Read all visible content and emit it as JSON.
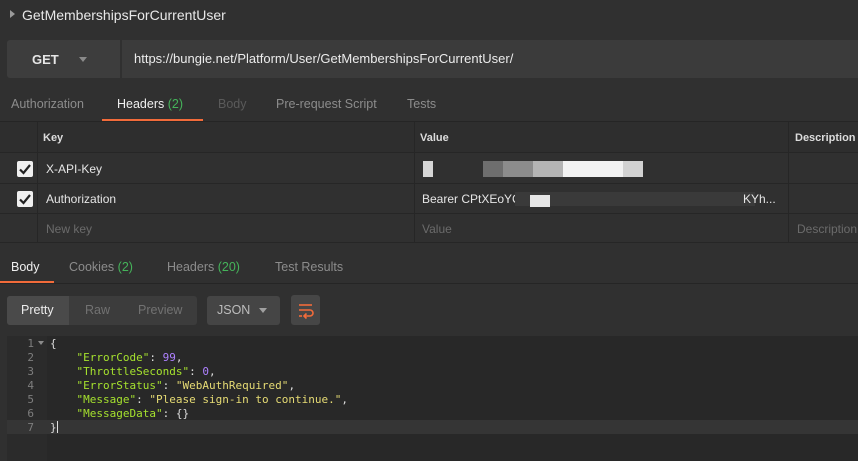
{
  "request": {
    "title": "GetMembershipsForCurrentUser",
    "method": "GET",
    "url": "https://bungie.net/Platform/User/GetMembershipsForCurrentUser/"
  },
  "request_tabs": {
    "authorization": "Authorization",
    "headers": "Headers",
    "headers_count": "(2)",
    "body": "Body",
    "pre_request": "Pre-request Script",
    "tests": "Tests"
  },
  "headers_table": {
    "col_key": "Key",
    "col_value": "Value",
    "col_description": "Description",
    "rows": [
      {
        "key": "X-API-Key",
        "value": "",
        "checked": true
      },
      {
        "key": "Authorization",
        "value": "Bearer CPtXEoYC",
        "value_tail": "KYh...",
        "checked": true
      }
    ],
    "new_key_placeholder": "New key",
    "value_placeholder": "Value",
    "description_placeholder": "Description"
  },
  "response_tabs": {
    "body": "Body",
    "cookies": "Cookies",
    "cookies_count": "(2)",
    "headers": "Headers",
    "headers_count": "(20)",
    "test_results": "Test Results"
  },
  "view_options": {
    "pretty": "Pretty",
    "raw": "Raw",
    "preview": "Preview",
    "format": "JSON"
  },
  "response_body": {
    "line_numbers": [
      "1",
      "2",
      "3",
      "4",
      "5",
      "6",
      "7"
    ],
    "open_brace": "{",
    "close_brace": "}",
    "fields": [
      {
        "key": "\"ErrorCode\"",
        "value": "99",
        "type": "number",
        "comma": ","
      },
      {
        "key": "\"ThrottleSeconds\"",
        "value": "0",
        "type": "number",
        "comma": ","
      },
      {
        "key": "\"ErrorStatus\"",
        "value": "\"WebAuthRequired\"",
        "type": "string",
        "comma": ","
      },
      {
        "key": "\"Message\"",
        "value": "\"Please sign-in to continue.\"",
        "type": "string",
        "comma": ","
      },
      {
        "key": "\"MessageData\"",
        "value": "{}",
        "type": "plain",
        "comma": ""
      }
    ]
  },
  "colors": {
    "accent": "#f26b3a",
    "count_green": "#45b35a",
    "json_key": "#a6e22e",
    "json_number": "#ae81ff",
    "json_string": "#e6db74"
  },
  "icons": {
    "collapse": "caret-right-icon",
    "method_dropdown": "chevron-down-icon",
    "checkbox": "checkmark-icon",
    "wrap": "wrap-lines-icon",
    "fold": "fold-arrow-icon"
  }
}
